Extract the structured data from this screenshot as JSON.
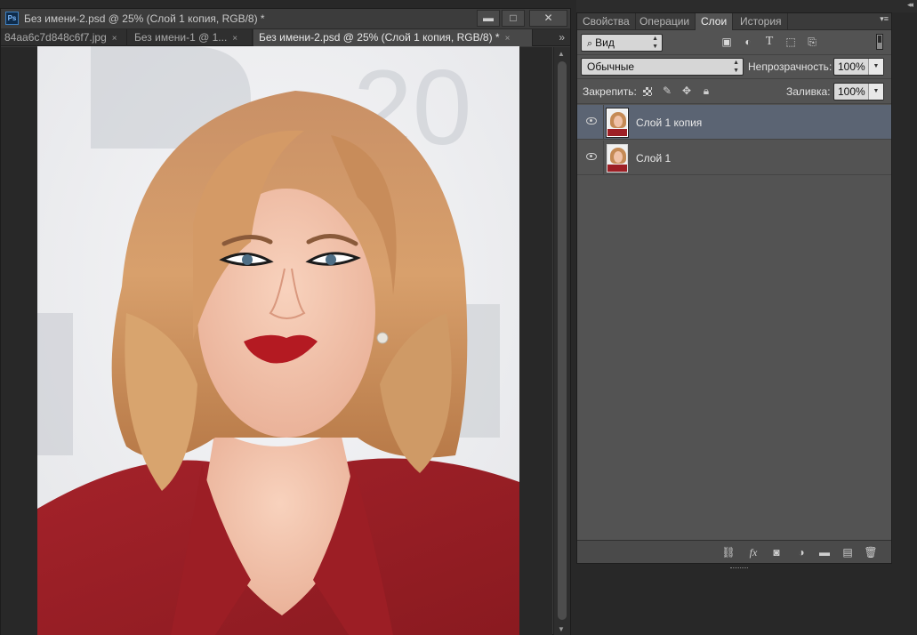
{
  "app": {
    "logo_text": "Ps",
    "window_title": "Без имени-2.psd @ 25% (Слой 1 копия, RGB/8) *"
  },
  "window_controls": {
    "minimize": "▬",
    "maximize": "□",
    "close": "✕"
  },
  "doc_tabs": [
    {
      "label": "84aa6c7d848c6f7.jpg",
      "active": false
    },
    {
      "label": "Без имени-1 @ 1...",
      "active": false
    },
    {
      "label": "Без имени-2.psd @ 25% (Слой 1 копия, RGB/8) *",
      "active": true
    }
  ],
  "tab_close_glyph": "×",
  "tab_overflow_glyph": "»",
  "panel": {
    "collapse_glyph": "◂◂",
    "menu_glyph": "▾≡",
    "tabs": [
      {
        "label": "Свойства",
        "active": false
      },
      {
        "label": "Операции",
        "active": false
      },
      {
        "label": "Слои",
        "active": true
      },
      {
        "label": "История",
        "active": false
      }
    ],
    "filter": {
      "kind_label": "Вид",
      "icons": [
        "image-icon",
        "adjustment-circle-icon",
        "type-icon",
        "shape-icon",
        "smart-object-icon"
      ]
    },
    "blend_mode": "Обычные",
    "opacity_label": "Непрозрачность:",
    "opacity_value": "100%",
    "lock_label": "Закрепить:",
    "fill_label": "Заливка:",
    "fill_value": "100%",
    "layers": [
      {
        "name": "Слой 1 копия",
        "selected": true,
        "visible": true
      },
      {
        "name": "Слой 1",
        "selected": false,
        "visible": true
      }
    ],
    "footer_icons": [
      "link-layers-icon",
      "fx-icon",
      "add-mask-icon",
      "new-adjustment-icon",
      "new-group-icon",
      "new-layer-icon",
      "trash-icon"
    ]
  },
  "colors": {
    "selected_layer": "#5b6473",
    "panel_bg": "#535353",
    "workspace_bg": "#282828"
  }
}
